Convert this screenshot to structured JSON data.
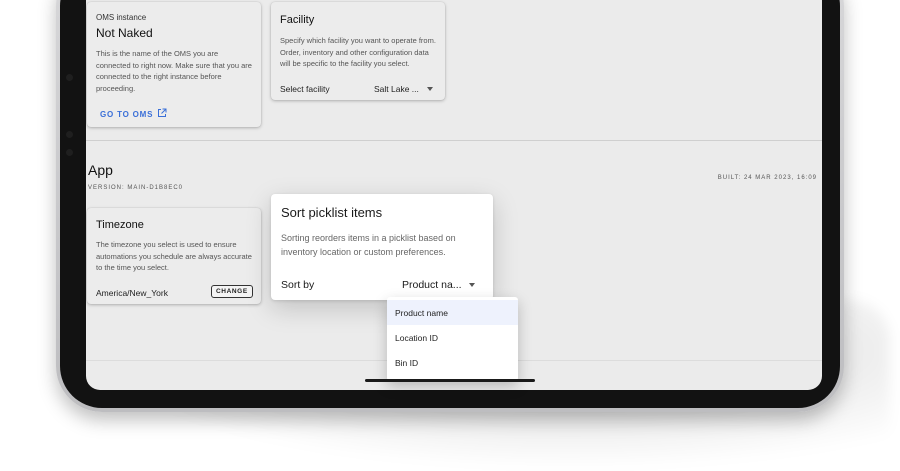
{
  "oms_card": {
    "overline": "OMS instance",
    "title": "Not Naked",
    "description": "This is the name of the OMS you are connected to right now. Make sure that you are connected to the right instance before proceeding.",
    "link_label": "GO TO OMS",
    "link_icon": "external-link-icon"
  },
  "facility_card": {
    "title": "Facility",
    "description": "Specify which facility you want to operate from. Order, inventory and other configuration data will be specific to the facility you select.",
    "select_label": "Select facility",
    "select_value": "Salt Lake ..."
  },
  "app_section": {
    "title": "App",
    "version": "VERSION: MAIN-D1B8EC0",
    "built": "BUILT: 24 MAR 2023, 16:09"
  },
  "timezone_card": {
    "title": "Timezone",
    "description": "The timezone you select is used to ensure automations you schedule are always accurate to the time you select.",
    "value": "America/New_York",
    "change_label": "CHANGE"
  },
  "sort_popover": {
    "title": "Sort picklist items",
    "description": "Sorting reorders items in a picklist based on inventory location or custom preferences.",
    "sort_label": "Sort by",
    "sort_value": "Product na..."
  },
  "sort_menu": {
    "options": [
      "Product name",
      "Location ID",
      "Bin ID"
    ],
    "selected": "Product name"
  },
  "colors": {
    "accent": "#3a6fd8",
    "selected_option_bg": "#eef2fd",
    "screen_bg": "#ebebeb"
  }
}
